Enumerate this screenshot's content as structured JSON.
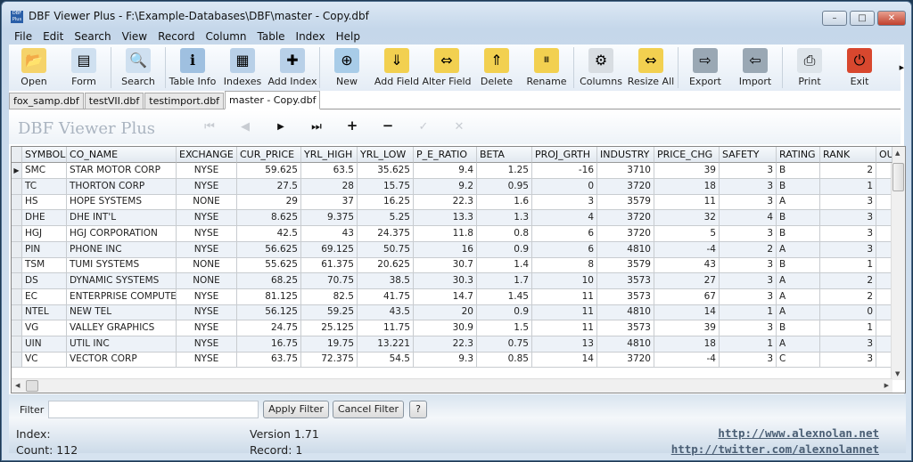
{
  "window": {
    "title": "DBF Viewer Plus - F:\\Example-Databases\\DBF\\master - Copy.dbf",
    "minimize": "–",
    "maximize": "□",
    "close": "✕"
  },
  "menu": [
    "File",
    "Edit",
    "Search",
    "View",
    "Record",
    "Column",
    "Table",
    "Index",
    "Help"
  ],
  "toolbar": [
    {
      "label": "Open",
      "icon": "folder-icon",
      "glyph": "📂",
      "color": "#f5d36a"
    },
    {
      "label": "Form",
      "icon": "form-icon",
      "glyph": "▤",
      "color": "#cfe0f0"
    },
    {
      "sep": true
    },
    {
      "label": "Search",
      "icon": "search-icon",
      "glyph": "🔍",
      "color": "#cfe0f0"
    },
    {
      "sep": true
    },
    {
      "label": "Table Info",
      "icon": "table-info-icon",
      "glyph": "ℹ",
      "color": "#9fc0e0"
    },
    {
      "label": "Indexes",
      "icon": "indexes-icon",
      "glyph": "▦",
      "color": "#b8d0e8"
    },
    {
      "label": "Add Index",
      "icon": "add-index-icon",
      "glyph": "✚",
      "color": "#b8d0e8"
    },
    {
      "sep": true
    },
    {
      "label": "New",
      "icon": "new-table-icon",
      "glyph": "⊕",
      "color": "#a8cce8"
    },
    {
      "label": "Add Field",
      "icon": "add-field-icon",
      "glyph": "⇓",
      "color": "#f2d050"
    },
    {
      "label": "Alter Field",
      "icon": "alter-field-icon",
      "glyph": "⇔",
      "color": "#f2d050"
    },
    {
      "label": "Delete",
      "icon": "delete-field-icon",
      "glyph": "⇑",
      "color": "#f2d050"
    },
    {
      "label": "Rename",
      "icon": "rename-field-icon",
      "glyph": "Ⅲ",
      "color": "#f2d050"
    },
    {
      "sep": true
    },
    {
      "label": "Columns",
      "icon": "columns-gear-icon",
      "glyph": "⚙",
      "color": "#d8dde2"
    },
    {
      "label": "Resize All",
      "icon": "resize-all-icon",
      "glyph": "⇔",
      "color": "#f2d050"
    },
    {
      "sep": true
    },
    {
      "label": "Export",
      "icon": "export-icon",
      "glyph": "⇨",
      "color": "#9aa8b4"
    },
    {
      "label": "Import",
      "icon": "import-icon",
      "glyph": "⇦",
      "color": "#9aa8b4"
    },
    {
      "sep": true
    },
    {
      "label": "Print",
      "icon": "printer-icon",
      "glyph": "⎙",
      "color": "#dde4ea"
    },
    {
      "label": "Exit",
      "icon": "exit-power-icon",
      "glyph": "⏻",
      "color": "#d8472e"
    }
  ],
  "rename_icon_text": "Rename",
  "tabs": [
    "fox_samp.dbf",
    "testVII.dbf",
    "testimport.dbf",
    "master - Copy.dbf"
  ],
  "active_tab": 3,
  "brand": "DBF Viewer Plus",
  "nav": {
    "first": "⏮",
    "prev": "◀",
    "next": "▶",
    "last": "⏭",
    "add": "+",
    "remove": "−",
    "save": "✓",
    "cancel": "✕"
  },
  "table": {
    "columns": [
      "SYMBOL",
      "CO_NAME",
      "EXCHANGE",
      "CUR_PRICE",
      "YRL_HIGH",
      "YRL_LOW",
      "P_E_RATIO",
      "BETA",
      "PROJ_GRTH",
      "INDUSTRY",
      "PRICE_CHG",
      "SAFETY",
      "RATING",
      "RANK",
      "OU"
    ],
    "rows": [
      [
        "SMC",
        "STAR MOTOR CORP",
        "NYSE",
        "59.625",
        "63.5",
        "35.625",
        "9.4",
        "1.25",
        "-16",
        "3710",
        "39",
        "3",
        "B",
        "2",
        ""
      ],
      [
        "TC",
        "THORTON CORP",
        "NYSE",
        "27.5",
        "28",
        "15.75",
        "9.2",
        "0.95",
        "0",
        "3720",
        "18",
        "3",
        "B",
        "1",
        ""
      ],
      [
        "HS",
        "HOPE SYSTEMS",
        "NONE",
        "29",
        "37",
        "16.25",
        "22.3",
        "1.6",
        "3",
        "3579",
        "11",
        "3",
        "A",
        "3",
        ""
      ],
      [
        "DHE",
        "DHE INT'L",
        "NYSE",
        "8.625",
        "9.375",
        "5.25",
        "13.3",
        "1.3",
        "4",
        "3720",
        "32",
        "4",
        "B",
        "3",
        ""
      ],
      [
        "HGJ",
        "HGJ CORPORATION",
        "NYSE",
        "42.5",
        "43",
        "24.375",
        "11.8",
        "0.8",
        "6",
        "3720",
        "5",
        "3",
        "B",
        "3",
        ""
      ],
      [
        "PIN",
        "PHONE INC",
        "NYSE",
        "56.625",
        "69.125",
        "50.75",
        "16",
        "0.9",
        "6",
        "4810",
        "-4",
        "2",
        "A",
        "3",
        ""
      ],
      [
        "TSM",
        "TUMI SYSTEMS",
        "NONE",
        "55.625",
        "61.375",
        "20.625",
        "30.7",
        "1.4",
        "8",
        "3579",
        "43",
        "3",
        "B",
        "1",
        ""
      ],
      [
        "DS",
        "DYNAMIC SYSTEMS",
        "NONE",
        "68.25",
        "70.75",
        "38.5",
        "30.3",
        "1.7",
        "10",
        "3573",
        "27",
        "3",
        "A",
        "2",
        ""
      ],
      [
        "EC",
        "ENTERPRISE COMPUTER",
        "NYSE",
        "81.125",
        "82.5",
        "41.75",
        "14.7",
        "1.45",
        "11",
        "3573",
        "67",
        "3",
        "A",
        "2",
        ""
      ],
      [
        "NTEL",
        "NEW TEL",
        "NYSE",
        "56.125",
        "59.25",
        "43.5",
        "20",
        "0.9",
        "11",
        "4810",
        "14",
        "1",
        "A",
        "0",
        ""
      ],
      [
        "VG",
        "VALLEY GRAPHICS",
        "NYSE",
        "24.75",
        "25.125",
        "11.75",
        "30.9",
        "1.5",
        "11",
        "3573",
        "39",
        "3",
        "B",
        "1",
        ""
      ],
      [
        "UIN",
        "UTIL INC",
        "NYSE",
        "16.75",
        "19.75",
        "13.221",
        "22.3",
        "0.75",
        "13",
        "4810",
        "18",
        "1",
        "A",
        "3",
        ""
      ],
      [
        "VC",
        "VECTOR CORP",
        "NYSE",
        "63.75",
        "72.375",
        "54.5",
        "9.3",
        "0.85",
        "14",
        "3720",
        "-4",
        "3",
        "C",
        "3",
        ""
      ]
    ],
    "current_row": 0
  },
  "filter": {
    "label": "Filter",
    "value": "",
    "apply": "Apply Filter",
    "cancel": "Cancel Filter",
    "help": "?"
  },
  "status": {
    "index": "Index:",
    "count": "Count: 112",
    "version": "Version 1.71",
    "record": "Record: 1"
  },
  "links": [
    "http://www.alexnolan.net",
    "http://twitter.com/alexnolannet"
  ]
}
